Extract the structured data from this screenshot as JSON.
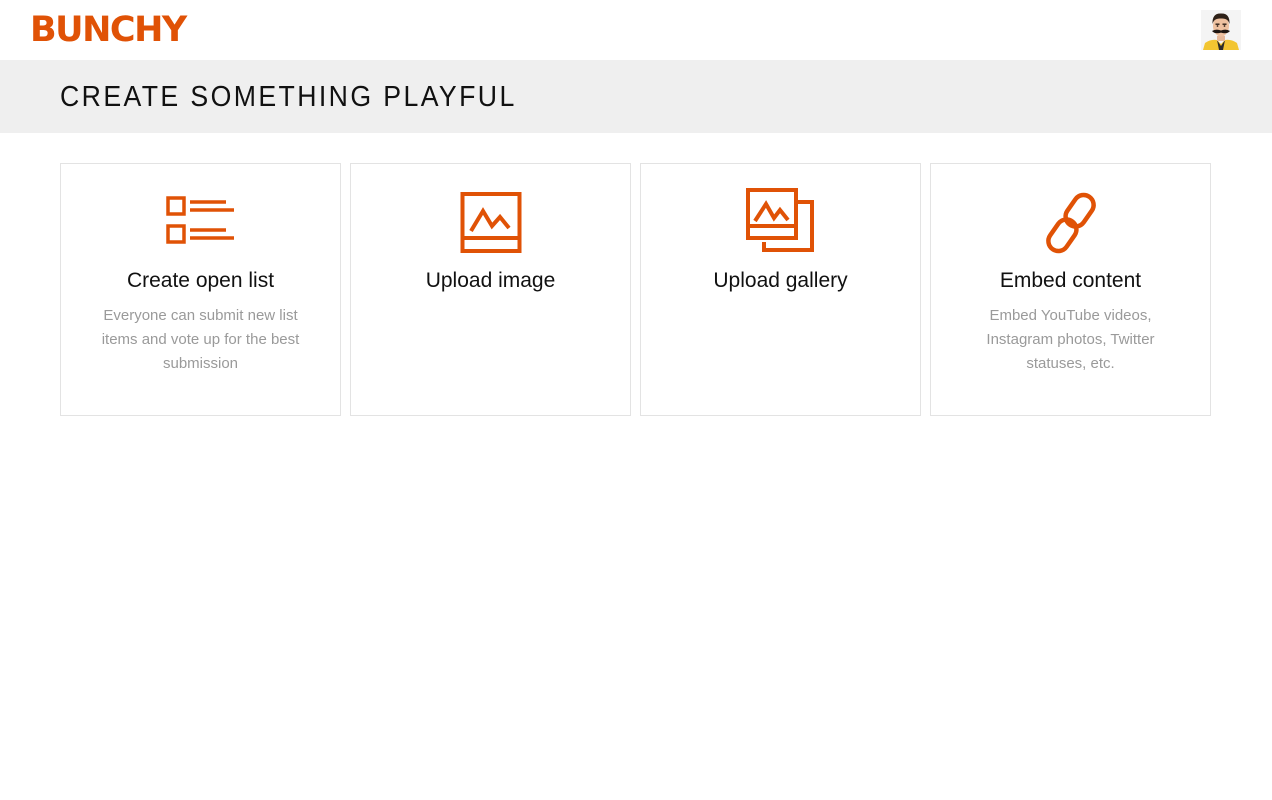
{
  "header": {
    "logo_text": "BUNCHY",
    "brand_color": "#e05206"
  },
  "banner": {
    "title": "CREATE SOMETHING PLAYFUL"
  },
  "cards": [
    {
      "icon": "list-icon",
      "title": "Create open list",
      "description": "Everyone can submit new list items and vote up for the best submission"
    },
    {
      "icon": "image-icon",
      "title": "Upload image",
      "description": ""
    },
    {
      "icon": "gallery-icon",
      "title": "Upload gallery",
      "description": ""
    },
    {
      "icon": "link-icon",
      "title": "Embed content",
      "description": "Embed YouTube videos, Instagram photos, Twitter statuses, etc."
    }
  ]
}
